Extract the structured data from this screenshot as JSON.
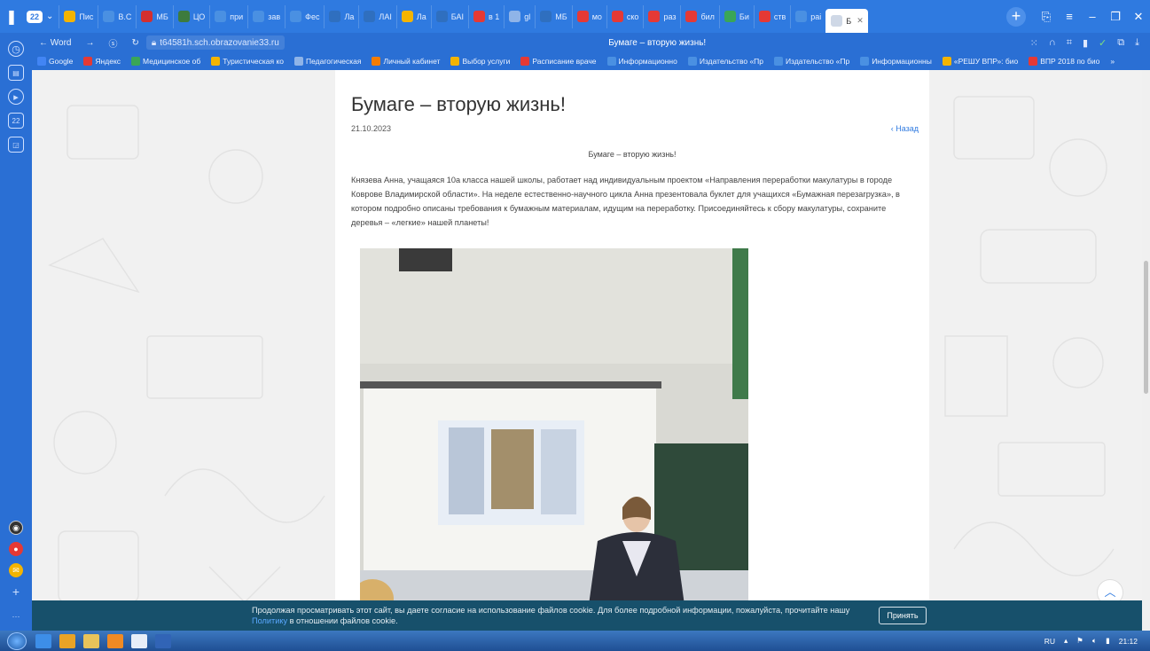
{
  "browser": {
    "tab_count": "22",
    "tabs": [
      {
        "label": "Пис",
        "color": "#f4b400"
      },
      {
        "label": "В.С",
        "color": "#4a90e2"
      },
      {
        "label": "МБ",
        "color": "#d32f2f"
      },
      {
        "label": "ЦО",
        "color": "#3d7b3d"
      },
      {
        "label": "при",
        "color": "#4a90e2"
      },
      {
        "label": "зав",
        "color": "#4a90e2"
      },
      {
        "label": "Фес",
        "color": "#4a90e2"
      },
      {
        "label": "Ла",
        "color": "#2f6fbf"
      },
      {
        "label": "ЛАІ",
        "color": "#2f6fbf"
      },
      {
        "label": "Ла",
        "color": "#f4b400"
      },
      {
        "label": "БАІ",
        "color": "#2f6fbf"
      },
      {
        "label": "в 1",
        "color": "#e53935"
      },
      {
        "label": "gl",
        "color": "#8fb4e8"
      },
      {
        "label": "МБ",
        "color": "#2f6fbf"
      },
      {
        "label": "мо",
        "color": "#e53935"
      },
      {
        "label": "ско",
        "color": "#e53935"
      },
      {
        "label": "раз",
        "color": "#e53935"
      },
      {
        "label": "бил",
        "color": "#e53935"
      },
      {
        "label": "Би",
        "color": "#3aa657"
      },
      {
        "label": "ств",
        "color": "#e53935"
      },
      {
        "label": "раі",
        "color": "#4a90e2"
      }
    ],
    "active_tab": "Б",
    "back_label": "← Word",
    "url": "t64581h.sch.obrazovanie33.ru",
    "page_title": "Бумаге – вторую жизнь!"
  },
  "bookmarks": [
    {
      "label": "Google",
      "color": "#4285f4"
    },
    {
      "label": "Яндекс",
      "color": "#e53935"
    },
    {
      "label": "Медицинское об",
      "color": "#3aa657"
    },
    {
      "label": "Туристическая ко",
      "color": "#f4b400"
    },
    {
      "label": "Педагогическая",
      "color": "#8fb4e8"
    },
    {
      "label": "Личный кабинет",
      "color": "#f57c00"
    },
    {
      "label": "Выбор услуги",
      "color": "#f4b400"
    },
    {
      "label": "Расписание враче",
      "color": "#e53935"
    },
    {
      "label": "Информационно",
      "color": "#4a90e2"
    },
    {
      "label": "Издательство «Пр",
      "color": "#4a90e2"
    },
    {
      "label": "Издательство «Пр",
      "color": "#4a90e2"
    },
    {
      "label": "Информационны",
      "color": "#4a90e2"
    },
    {
      "label": "«РЕШУ ВПР»: био",
      "color": "#f4b400"
    },
    {
      "label": "ВПР 2018 по био",
      "color": "#e53935"
    }
  ],
  "article": {
    "title": "Бумаге – вторую жизнь!",
    "date": "21.10.2023",
    "back_link": "‹ Назад",
    "subtitle": "Бумаге – вторую жизнь!",
    "body": "Князева Анна, учащаяся 10а класса нашей школы, работает над индивидуальным проектом «Направления переработки макулатуры в городе Коврове Владимирской области». На неделе естественно-научного цикла Анна презентовала буклет для учащихся «Бумажная перезагрузка», в котором подробно описаны требования к бумажным материалам, идущим на переработку. Присоединяйтесь к сбору макулатуры, сохраните деревья – «легкие» нашей планеты!"
  },
  "cookie": {
    "text_before": "Продолжая просматривать этот сайт, вы даете согласие на использование файлов cookie. Для более подробной информации, пожалуйста, прочитайте нашу",
    "link": "Политику",
    "text_after": "в отношении файлов cookie.",
    "accept_label": "Принять"
  },
  "taskbar": {
    "lang": "RU",
    "time": "21:12"
  }
}
